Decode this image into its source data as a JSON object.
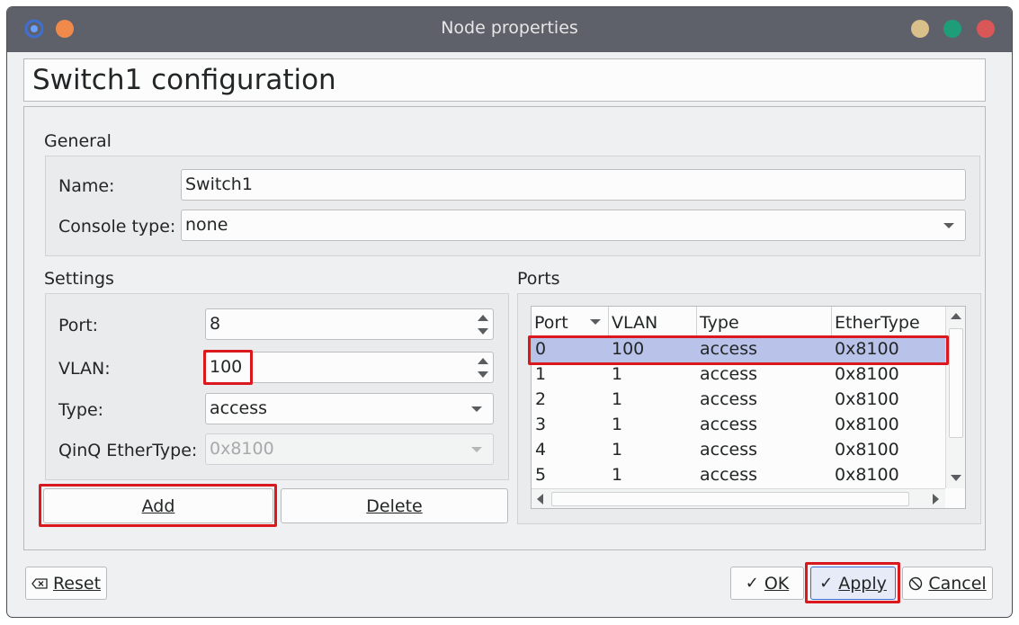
{
  "window": {
    "title": "Node properties",
    "colors": {
      "titlebar": "#5f616a",
      "close_dot": "#d95757",
      "max_dot": "#1e9e78",
      "min_dot": "#d9c08a",
      "menu_dot": "#ef8a4a"
    }
  },
  "header": {
    "title": "Switch1 configuration"
  },
  "general": {
    "group_title": "General",
    "name_label": "Name:",
    "name_value": "Switch1",
    "console_label": "Console type:",
    "console_value": "none"
  },
  "settings": {
    "group_title": "Settings",
    "port_label": "Port:",
    "port_value": "8",
    "vlan_label": "VLAN:",
    "vlan_value": "100",
    "type_label": "Type:",
    "type_value": "access",
    "qinq_label": "QinQ EtherType:",
    "qinq_value": "0x8100",
    "add_label": "Add",
    "delete_label": "Delete"
  },
  "ports": {
    "group_title": "Ports",
    "columns": [
      "Port",
      "VLAN",
      "Type",
      "EtherType"
    ],
    "rows": [
      [
        "0",
        "100",
        "access",
        "0x8100"
      ],
      [
        "1",
        "1",
        "access",
        "0x8100"
      ],
      [
        "2",
        "1",
        "access",
        "0x8100"
      ],
      [
        "3",
        "1",
        "access",
        "0x8100"
      ],
      [
        "4",
        "1",
        "access",
        "0x8100"
      ],
      [
        "5",
        "1",
        "access",
        "0x8100"
      ]
    ],
    "selected_row": 0,
    "selection_color": "#b9c3e9"
  },
  "footer": {
    "reset_label": "Reset",
    "ok_label": "OK",
    "apply_label": "Apply",
    "cancel_label": "Cancel"
  },
  "highlight_color": "#d9191d"
}
